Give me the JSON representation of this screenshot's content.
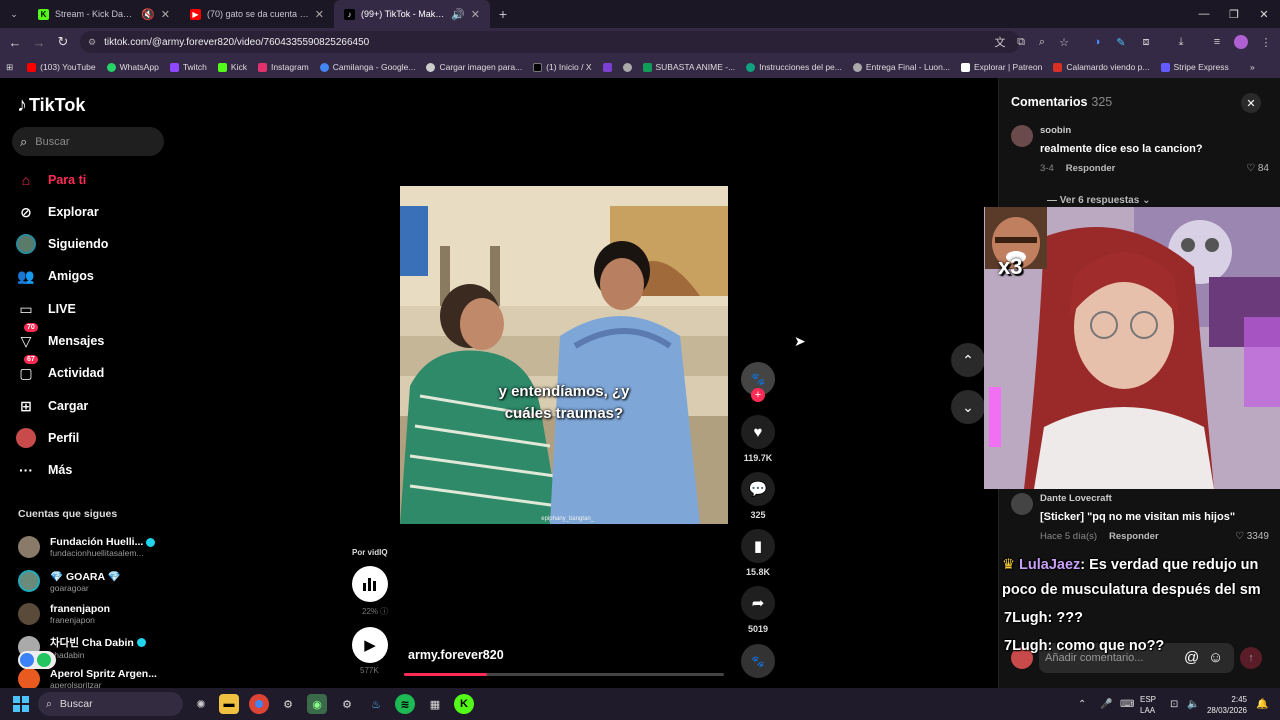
{
  "browser": {
    "tabs": [
      {
        "title": "Stream - Kick Dashboard",
        "icon": "kick-icon"
      },
      {
        "title": "(70) gato se da cuenta que lo g",
        "icon": "youtube-icon"
      },
      {
        "title": "(99+) TikTok - Make Your D",
        "icon": "tiktok-icon"
      }
    ],
    "url": "tiktok.com/@army.forever820/video/7604335590825266450",
    "bookmarks": [
      {
        "label": "(103) YouTube",
        "color": "#ff0000"
      },
      {
        "label": "WhatsApp",
        "color": "#25d366"
      },
      {
        "label": "Twitch",
        "color": "#9146ff"
      },
      {
        "label": "Kick",
        "color": "#53fc18"
      },
      {
        "label": "Instagram",
        "color": "#e1306c"
      },
      {
        "label": "Camilanga - Google...",
        "color": "#4285f4"
      },
      {
        "label": "Cargar imagen para...",
        "color": "#cccccc"
      },
      {
        "label": "(1) Inicio / X",
        "color": "#000000"
      },
      {
        "label": "",
        "color": "#7b3fd4"
      },
      {
        "label": "",
        "color": "#aaaaaa"
      },
      {
        "label": "SUBASTA ANIME -...",
        "color": "#0f9d58"
      },
      {
        "label": "Instrucciones del pe...",
        "color": "#10a37f"
      },
      {
        "label": "Entrega Final - Luon...",
        "color": "#aaaaaa"
      },
      {
        "label": "Explorar | Patreon",
        "color": "#ffffff"
      },
      {
        "label": "Calamardo viendo p...",
        "color": "#d93025"
      },
      {
        "label": "Stripe Express",
        "color": "#635bff"
      }
    ]
  },
  "tiktok": {
    "logo": "TikTok",
    "search_placeholder": "Buscar",
    "nav": [
      {
        "label": "Para ti",
        "icon": "home-icon",
        "active": true
      },
      {
        "label": "Explorar",
        "icon": "compass-icon"
      },
      {
        "label": "Siguiendo",
        "icon": "following-avatar-icon"
      },
      {
        "label": "Amigos",
        "icon": "friends-icon"
      },
      {
        "label": "LIVE",
        "icon": "live-icon"
      },
      {
        "label": "Mensajes",
        "icon": "send-icon",
        "badge": "70"
      },
      {
        "label": "Actividad",
        "icon": "inbox-icon",
        "badge": "67"
      },
      {
        "label": "Cargar",
        "icon": "upload-icon"
      },
      {
        "label": "Perfil",
        "icon": "profile-avatar-icon"
      },
      {
        "label": "Más",
        "icon": "more-icon"
      }
    ],
    "following_title": "Cuentas que sigues",
    "following": [
      {
        "name": "Fundación Huelli...",
        "handle": "fundacionhuellitasalem...",
        "verified": true
      },
      {
        "name": "💎 GOARA 💎",
        "handle": "goaragoar",
        "verified": false
      },
      {
        "name": "franenjapon",
        "handle": "franenjapon",
        "verified": false
      },
      {
        "name": "차다빈 Cha Dabin",
        "handle": "chadabin",
        "verified": true
      },
      {
        "name": "Aperol Spritz Argen...",
        "handle": "aperolspritzar",
        "verified": false
      }
    ],
    "video": {
      "caption_line1": "y entendíamos, ¿y",
      "caption_line2": "cuáles traumas?",
      "watermark": "epiphany_bangtan_",
      "author": "army.forever820",
      "progress": 0.26
    },
    "actions": {
      "likes": "119.7K",
      "comments": "325",
      "saves": "15.8K",
      "shares": "5019"
    },
    "por_label": "Por vidIQ",
    "vidiq_percent": "22%",
    "plays": "577K"
  },
  "comments": {
    "title": "Comentarios",
    "count": "325",
    "items": [
      {
        "user": "soobin",
        "text": "realmente dice eso la cancion?",
        "date": "3-4",
        "reply": "Responder",
        "likes": "84"
      },
      {
        "user": "Dante Lovecraft",
        "text": "[Sticker] \"pq no me visitan mis hijos\"",
        "date": "Hace 5 día(s)",
        "reply": "Responder",
        "likes": "3349"
      }
    ],
    "view_replies": "Ver 6 respuestas",
    "input_placeholder": "Añadir comentario..."
  },
  "stream_overlay": {
    "reaction_multiplier": "x3",
    "chat": [
      {
        "user": "LulaJaez",
        "msg": ": Es verdad que redujo un"
      },
      {
        "user": "",
        "msg": "poco de musculatura después del sm"
      },
      {
        "user": "7Lugh",
        "msg": ": ???"
      },
      {
        "user": "7Lugh",
        "msg": ": como que no??"
      }
    ]
  },
  "taskbar": {
    "search_label": "Buscar",
    "lang_line1": "ESP",
    "lang_line2": "LAA",
    "time": "2:45",
    "date": "28/03/2026"
  }
}
